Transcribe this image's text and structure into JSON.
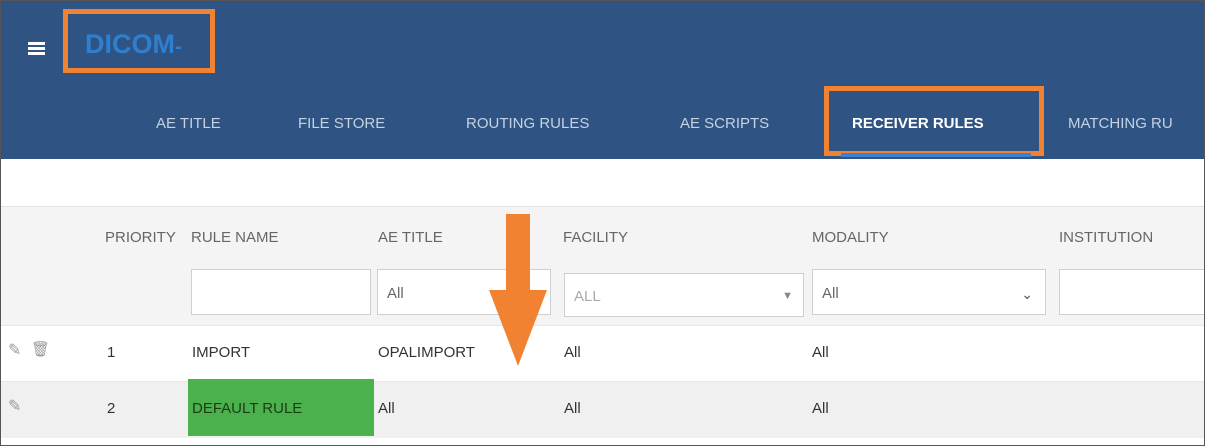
{
  "header": {
    "brand": "DICOM",
    "brand_suffix": "-",
    "brand_color": "#2f7fd0",
    "bar_color": "#2f5483",
    "highlight_color": "#f08232",
    "tabs": [
      "AE TITLE",
      "FILE STORE",
      "ROUTING RULES",
      "AE SCRIPTS",
      "RECEIVER RULES",
      "MATCHING RU"
    ],
    "active_tab": "RECEIVER RULES"
  },
  "grid": {
    "columns": [
      "PRIORITY",
      "RULE NAME",
      "AE TITLE",
      "FACILITY",
      "MODALITY",
      "INSTITUTION"
    ],
    "filters": {
      "rule_name": "",
      "ae_title": "All",
      "facility": "ALL",
      "modality": "All",
      "institution": ""
    },
    "rows": [
      {
        "priority": "1",
        "rule_name": "IMPORT",
        "ae_title": "OPALIMPORT",
        "facility": "All",
        "modality": "All"
      },
      {
        "priority": "2",
        "rule_name": "DEFAULT RULE",
        "ae_title": "All",
        "facility": "All",
        "modality": "All"
      }
    ],
    "row_actions": [
      "pencil-icon",
      "trash-icon"
    ],
    "highlight_cell_color": "#4ab14c"
  }
}
